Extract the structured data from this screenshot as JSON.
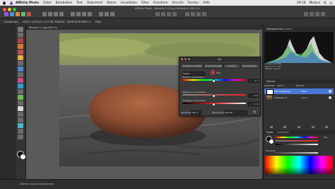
{
  "menubar": {
    "app_name": "Affinity Photo",
    "items": [
      "Datei",
      "Bearbeiten",
      "Text",
      "Dokument",
      "Ebene",
      "Auswählen",
      "Filter",
      "Anordnen",
      "Ansicht",
      "Fenster",
      "Hilfe"
    ],
    "clock": "09:18",
    "user": "Markus"
  },
  "window": {
    "title": "Affinity Photo - Beispiel_0-4.jpg (Geändert) (66,1%)"
  },
  "context_toolbar": {
    "items": [
      "Schwenken",
      "2000 x 1330 px, 9,73 MP, RGBA/8 - sRGB IEC61966-2.1",
      "Pixel"
    ]
  },
  "document_tab": {
    "label": "Beispiel_0-4.jpg (66,1%)"
  },
  "hsl_dialog": {
    "title": "HSL",
    "tabs": [
      "Vorlage hinzufügen",
      "Zusammenlegen",
      "Löschen",
      "Zurücksetzen"
    ],
    "master_label": "Master",
    "hsv_label": "HSV",
    "rows": [
      {
        "label": "Farbton verschieben",
        "value": "0 °"
      },
      {
        "label": "Sättigung verschieben",
        "value": "0 %"
      },
      {
        "label": "Helligkeit verschieben",
        "value": "0 %"
      }
    ],
    "opacity_label": "Deckkraft",
    "opacity_value": "100 %",
    "blend_label": "Mischmodus",
    "blend_value": "Normal"
  },
  "panels": {
    "histogram_tab": "Histogramm",
    "navigator_tab": "Navigator",
    "histogram_stats": [
      "Anzahl: 2,16 Mio",
      "Bereich: 0 - 255",
      "Mittelw: 116,32"
    ],
    "layers_tab": "Ebenen",
    "opacity_label": "Deckkraft",
    "opacity_value": "100 %",
    "blend_value": "Normal",
    "color_tab": "Farbe",
    "swatches_tab": "Farbfelder",
    "color_mode": "HSL",
    "opacity_slider_label": "Deckkraft"
  },
  "layers": [
    {
      "name": "HSL-Anpassung",
      "tag": "(HSL)"
    },
    {
      "name": "Hintergrund",
      "tag": "(Pixel)"
    }
  ],
  "status": {
    "text": "Ziehen: Ansicht schwenken."
  },
  "colors": {
    "accent": "#4a78d6",
    "panel": "#323232",
    "canvas": "#5a5a5a"
  }
}
